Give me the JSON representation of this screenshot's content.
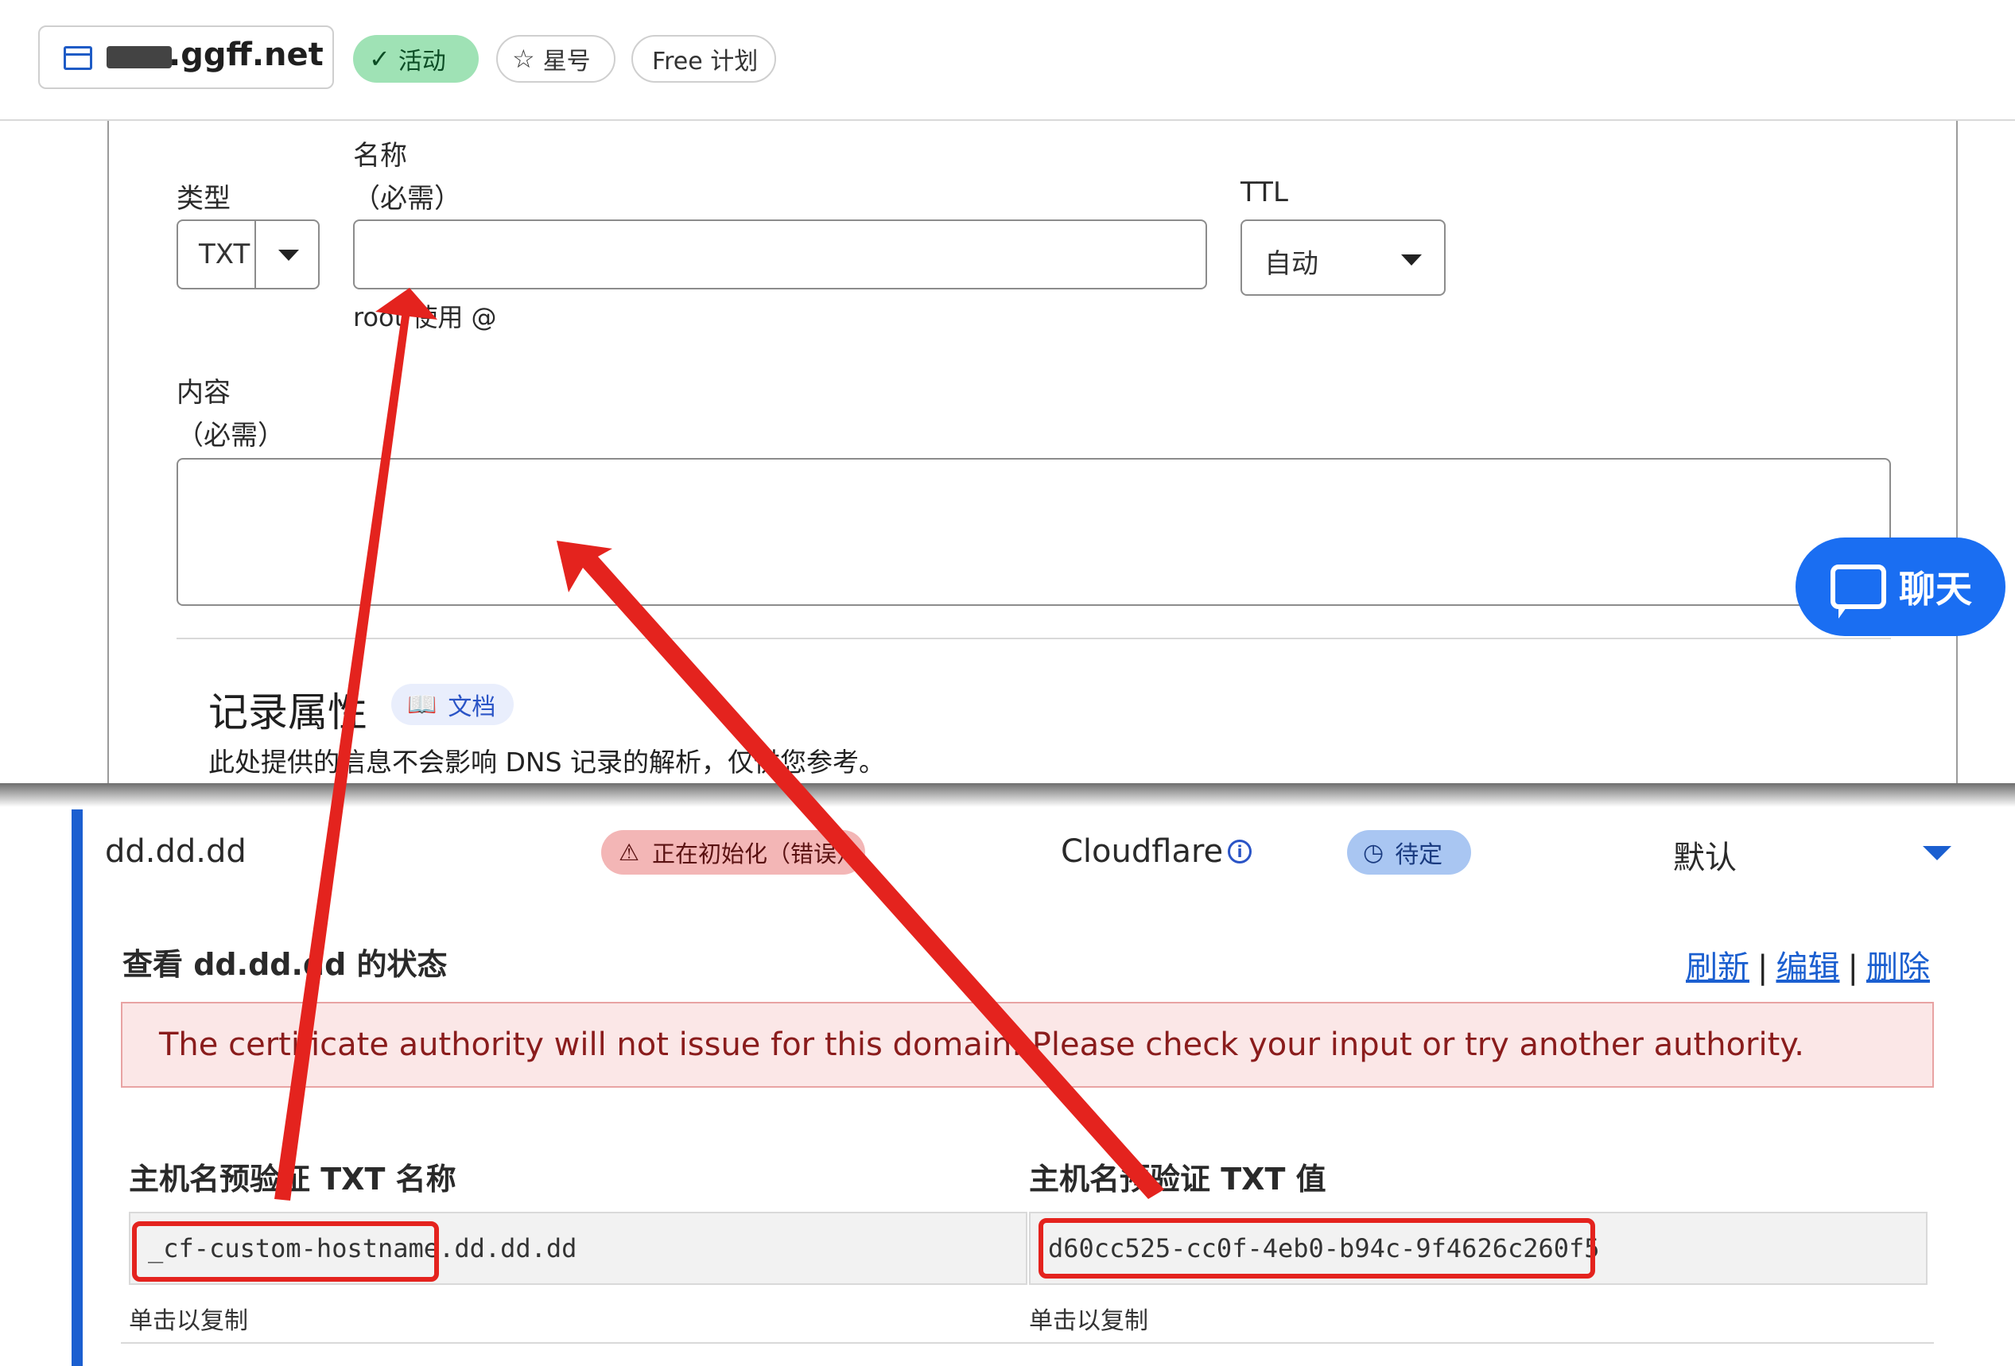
{
  "header": {
    "domain": ".ggff.net",
    "badges": {
      "active": "活动",
      "star": "星号",
      "plan": "Free 计划"
    }
  },
  "dns_form": {
    "type_label": "类型",
    "type_value": "TXT",
    "name_label": "名称",
    "name_required": "（必需）",
    "name_hint": "root 使用 @",
    "ttl_label": "TTL",
    "ttl_value": "自动",
    "content_label": "内容",
    "content_required": "（必需）",
    "section_title": "记录属性",
    "docs_label": "文档",
    "section_desc": "此处提供的信息不会影响 DNS 记录的解析，仅供您参考。"
  },
  "chat": {
    "label": "聊天"
  },
  "hostname_row": {
    "hostname": "dd.dd.dd",
    "status": "正在初始化（错误）",
    "provider": "Cloudflare",
    "validation": "待定",
    "default_label": "默认"
  },
  "status_panel": {
    "title": "查看 dd.dd.dd 的状态",
    "actions": {
      "refresh": "刷新",
      "edit": "编辑",
      "delete": "删除"
    },
    "error_message": "The certificate authority will not issue for this domain. Please check your input or try another authority.",
    "txt_name_label": "主机名预验证 TXT 名称",
    "txt_name_value": "_cf-custom-hostname.dd.dd.dd",
    "txt_value_label": "主机名预验证 TXT 值",
    "txt_value": "d60cc525-cc0f-4eb0-b94c-9f4626c260f5",
    "copy_hint": "单击以复制"
  },
  "colors": {
    "accent": "#1b5fd0",
    "annotation_red": "#e4231e",
    "active_badge": "#9fe2b5",
    "error_badge": "#f3b6b6",
    "pending_badge": "#a9c6f2",
    "chat_button": "#1a6ef2"
  },
  "icons": [
    "browser-window-icon",
    "checkmark-icon",
    "star-icon",
    "book-icon",
    "chat-bubble-icon",
    "warning-triangle-icon",
    "info-icon",
    "clock-icon",
    "caret-down-icon"
  ]
}
